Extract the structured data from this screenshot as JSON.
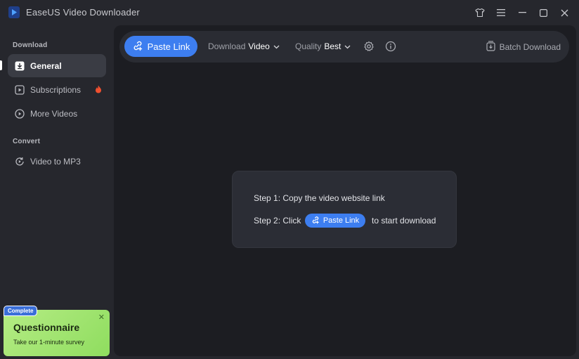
{
  "app": {
    "title": "EaseUS Video Downloader"
  },
  "window_controls": [
    "tshirt-icon",
    "menu-icon",
    "minimize-icon",
    "maximize-icon",
    "close-icon"
  ],
  "sidebar": {
    "sections": [
      {
        "label": "Download"
      },
      {
        "label": "Convert"
      }
    ],
    "items": [
      {
        "label": "General",
        "icon": "download-box-icon",
        "active": true
      },
      {
        "label": "Subscriptions",
        "icon": "play-square-icon",
        "hot": true
      },
      {
        "label": "More Videos",
        "icon": "play-circle-icon"
      },
      {
        "label": "Video to MP3",
        "icon": "convert-icon"
      }
    ]
  },
  "promo": {
    "badge": "Complete",
    "title": "Questionnaire",
    "subtitle": "Take our 1-minute survey"
  },
  "toolbar": {
    "paste_label": "Paste Link",
    "download_label": "Download",
    "download_value": "Video",
    "quality_label": "Quality",
    "quality_value": "Best",
    "batch_label": "Batch Download"
  },
  "steps": {
    "step1": "Step 1: Copy the video website link",
    "step2_prefix": "Step 2: Click",
    "step2_button": "Paste Link",
    "step2_suffix": "to start download"
  },
  "colors": {
    "accent": "#3d7ef0",
    "promo": "#a6e574",
    "hot": "#f0502f"
  }
}
